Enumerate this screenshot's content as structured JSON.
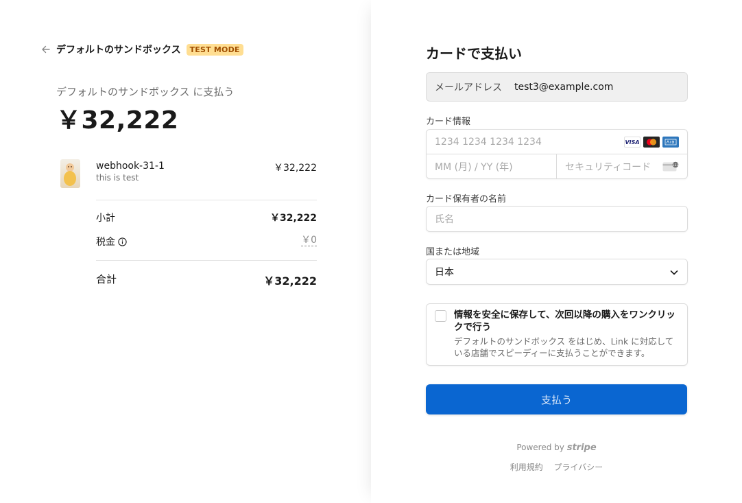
{
  "summary": {
    "merchant_name": "デフォルトのサンドボックス",
    "test_mode_badge": "TEST MODE",
    "pay_to": "デフォルトのサンドボックス に支払う",
    "amount": "￥32,222",
    "product": {
      "name": "webhook-31-1",
      "description": "this is test",
      "price": "￥32,222"
    },
    "subtotal_label": "小計",
    "subtotal_value": "￥32,222",
    "tax_label": "税金",
    "tax_value": "￥0",
    "total_label": "合計",
    "total_value": "￥32,222"
  },
  "form": {
    "title": "カードで支払い",
    "email_label": "メールアドレス",
    "email_value": "test3@example.com",
    "card_label": "カード情報",
    "card_number_placeholder": "1234 1234 1234 1234",
    "card_brands": [
      "VISA",
      "mastercard",
      "AMEX"
    ],
    "expiry_placeholder": "MM (月) / YY (年)",
    "cvc_placeholder": "セキュリティコード",
    "name_label": "カード保有者の名前",
    "name_placeholder": "氏名",
    "country_label": "国または地域",
    "country_value": "日本",
    "save_title": "情報を安全に保存して、次回以降の購入をワンクリックで行う",
    "save_desc": "デフォルトのサンドボックス をはじめ、Link に対応している店舗でスピーディーに支払うことができます。",
    "pay_button": "支払う"
  },
  "footer": {
    "powered_by": "Powered by",
    "stripe": "stripe",
    "terms": "利用規約",
    "privacy": "プライバシー"
  },
  "colors": {
    "accent": "#0a66d1",
    "badge_bg": "#ffde92",
    "badge_text": "#a04e00"
  }
}
